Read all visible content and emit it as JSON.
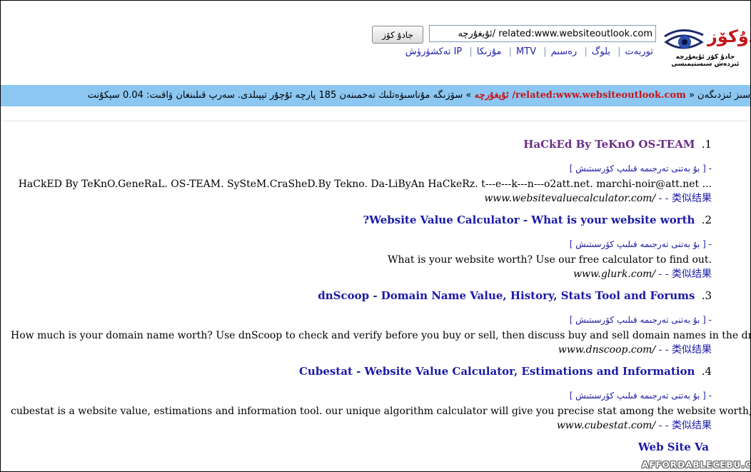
{
  "header": {
    "logo_text": "جادۇكۆز",
    "logo_subtitle": "جادۇ كۆز ئۇيغۇرچە ئىزدەش سىستېمىسى",
    "search_value": "related:www.websiteoutlook.com /ئۇيغۇرچە",
    "search_button": "جادۇ كۆز",
    "nav": [
      "توربەت",
      "بلوگ",
      "رەسىم",
      "MTV",
      "مۇزىكا",
      "IP تەكشۈرۈش"
    ]
  },
  "status": {
    "prefix": "سىز ئىزدىگەن «",
    "query": "related:www.websiteoutlook.com/ ئۇيغۇرچە",
    "suffix": "» سۆزىگە مۇناسىۋەتلىك تەخمىنەن 185 پارچە ئۇچۇر تېپىلدى. سەرپ قىلىنغان ۋاقىت: 0.04 سېكۇنت"
  },
  "translate_label": "- [ بۇ بەتنى تەرجىمە قىلىپ كۆرسىتىش ]",
  "similar_label": "类似结果",
  "dash_label": "- -",
  "results": [
    {
      "num": ".1",
      "title": "HaCkEd By TeKnO OS-TEAM",
      "desc": "HaCkED By TeKnO.GeneRaL. OS-TEAM. SySteM.CraSheD.By Tekno. Da-LiByAn HaCkeRz. t---e---k---n---o2att.net. marchi-noir@att.net ...",
      "url": "www.websitevaluecalculator.com/"
    },
    {
      "num": ".2",
      "title": "?Website Value Calculator - What is your website worth",
      "desc": "What is your website worth? Use our free calculator to find out.",
      "url": "www.glurk.com/"
    },
    {
      "num": ".3",
      "title": "dnScoop - Domain Name Value, History, Stats Tool and Forums",
      "desc": "How much is your domain name worth? Use dnScoop to check and verify before you buy or sell, then discuss buy and sell domain names in the dnscoop forums.",
      "url": "www.dnscoop.com/"
    },
    {
      "num": ".4",
      "title": "Cubestat - Website Value Calculator, Estimations and Information",
      "desc": "cubestat is a website value, estimations and information tool. our unique algorithm calculator will give you precise stat among the website worth, ...",
      "url": "www.cubestat.com/"
    },
    {
      "num": "",
      "title": "Web Site Va",
      "desc": "",
      "url": ""
    }
  ],
  "watermark": "AFFORDABLECEBU.COM",
  "colors": {
    "link": "#1a1aa6",
    "visited": "#6b2d8a",
    "status_bar": "#8cc7f2",
    "brand_red": "#c4161c"
  }
}
